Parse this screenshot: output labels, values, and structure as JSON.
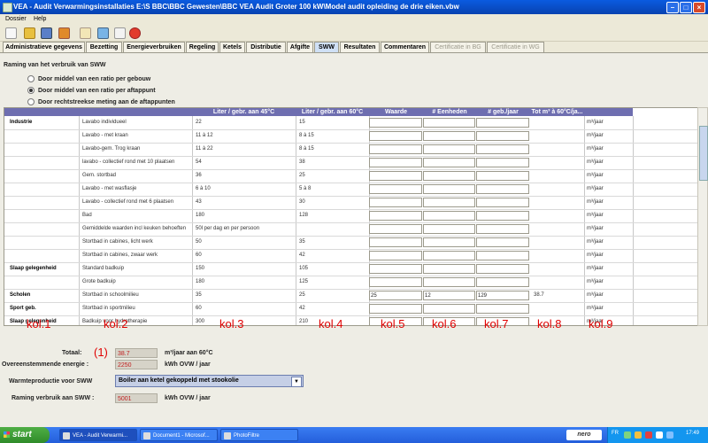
{
  "window": {
    "title": "VEA - Audit Verwarmingsinstallaties E:\\S BBC\\BBC Gewesten\\BBC VEA Audit Groter 100 kW\\Model audit opleiding de drie eiken.vbw"
  },
  "menu": [
    "Dossier",
    "Help"
  ],
  "tabs": [
    {
      "label": "Administratieve gegevens",
      "state": "normal"
    },
    {
      "label": "Bezetting",
      "state": "normal"
    },
    {
      "label": "Energieverbruiken",
      "state": "normal"
    },
    {
      "label": "Regeling",
      "state": "normal"
    },
    {
      "label": "Ketels",
      "state": "normal"
    },
    {
      "label": "Distributie",
      "state": "normal"
    },
    {
      "label": "Afgifte",
      "state": "normal"
    },
    {
      "label": "SWW",
      "state": "active"
    },
    {
      "label": "Resultaten",
      "state": "normal"
    },
    {
      "label": "Commentaren",
      "state": "normal"
    },
    {
      "label": "Certificatie in BG",
      "state": "disabled"
    },
    {
      "label": "Certificatie in WG",
      "state": "disabled"
    }
  ],
  "section": {
    "title": "Raming van het verbruik van SWW",
    "options": [
      {
        "label": "Door middel van een ratio per gebouw",
        "selected": false
      },
      {
        "label": "Door middel van een ratio per aftappunt",
        "selected": true
      },
      {
        "label": "Door rechtstreekse meting aan de aftappunten",
        "selected": false
      }
    ]
  },
  "table": {
    "headers": [
      "",
      "",
      "Liter / gebr. aan 45°C",
      "Liter / gebr. aan 60°C",
      "Waarde",
      "# Eenheden",
      "# geb./jaar",
      "Tot m³ à 60°C/ja...",
      ""
    ],
    "rows": [
      {
        "cat": "Industrie",
        "item": "Lavabo individueel",
        "l45": "22",
        "l60": "15",
        "waarde": "",
        "eenheden": "",
        "geb": "",
        "tot": "",
        "unit": "m³/jaar"
      },
      {
        "cat": "",
        "item": "Lavabo - met kraan",
        "l45": "11 à 12",
        "l60": "8 à 15",
        "waarde": "",
        "eenheden": "",
        "geb": "",
        "tot": "",
        "unit": "m³/jaar"
      },
      {
        "cat": "",
        "item": "Lavabo-gem. Trog kraan",
        "l45": "11 à 22",
        "l60": "8 à 15",
        "waarde": "",
        "eenheden": "",
        "geb": "",
        "tot": "",
        "unit": "m³/jaar"
      },
      {
        "cat": "",
        "item": "lavabo - collectief rond met 10 plaatsen",
        "l45": "54",
        "l60": "38",
        "waarde": "",
        "eenheden": "",
        "geb": "",
        "tot": "",
        "unit": "m³/jaar"
      },
      {
        "cat": "",
        "item": "Gem. stortbad",
        "l45": "36",
        "l60": "25",
        "waarde": "",
        "eenheden": "",
        "geb": "",
        "tot": "",
        "unit": "m³/jaar"
      },
      {
        "cat": "",
        "item": "Lavabo - met wasflasje",
        "l45": "6 à 10",
        "l60": "5 à 8",
        "waarde": "",
        "eenheden": "",
        "geb": "",
        "tot": "",
        "unit": "m³/jaar"
      },
      {
        "cat": "",
        "item": "Lavabo - collectief rond met 6 plaatsen",
        "l45": "43",
        "l60": "30",
        "waarde": "",
        "eenheden": "",
        "geb": "",
        "tot": "",
        "unit": "m³/jaar"
      },
      {
        "cat": "",
        "item": "Bad",
        "l45": "180",
        "l60": "128",
        "waarde": "",
        "eenheden": "",
        "geb": "",
        "tot": "",
        "unit": "m³/jaar"
      },
      {
        "cat": "",
        "item": "Gemiddelde waarden incl keuken behoeften",
        "l45": "50l per dag en per persoon",
        "l60": "",
        "waarde": "",
        "eenheden": "",
        "geb": "",
        "tot": "",
        "unit": "m³/jaar"
      },
      {
        "cat": "",
        "item": "Stortbad in cabines, licht werk",
        "l45": "50",
        "l60": "35",
        "waarde": "",
        "eenheden": "",
        "geb": "",
        "tot": "",
        "unit": "m³/jaar"
      },
      {
        "cat": "",
        "item": "Stortbad in cabines, zwaar werk",
        "l45": "60",
        "l60": "42",
        "waarde": "",
        "eenheden": "",
        "geb": "",
        "tot": "",
        "unit": "m³/jaar"
      },
      {
        "cat": "Slaap gelegenheid",
        "item": "Standard badkuip",
        "l45": "150",
        "l60": "105",
        "waarde": "",
        "eenheden": "",
        "geb": "",
        "tot": "",
        "unit": "m³/jaar"
      },
      {
        "cat": "",
        "item": "Grote badkuip",
        "l45": "180",
        "l60": "125",
        "waarde": "",
        "eenheden": "",
        "geb": "",
        "tot": "",
        "unit": "m³/jaar"
      },
      {
        "cat": "Scholen",
        "item": "Stortbad in schoolmilieu",
        "l45": "35",
        "l60": "25",
        "waarde": "25",
        "eenheden": "12",
        "geb": "129",
        "tot": "38.7",
        "unit": "m³/jaar"
      },
      {
        "cat": "Sport geb.",
        "item": "Stortbad in sportmilieu",
        "l45": "60",
        "l60": "42",
        "waarde": "",
        "eenheden": "",
        "geb": "",
        "tot": "",
        "unit": "m³/jaar"
      },
      {
        "cat": "Slaap gelegenheid",
        "item": "Badkuip voor hydrotherapie",
        "l45": "300",
        "l60": "210",
        "waarde": "",
        "eenheden": "",
        "geb": "",
        "tot": "",
        "unit": "m³/jaar"
      }
    ]
  },
  "annotations": {
    "columns": [
      "kol.1",
      "kol.2",
      "kol.3",
      "kol.4",
      "kol.5",
      "kol.6",
      "kol.7",
      "kol.8",
      "kol.9"
    ],
    "marker": "(1)"
  },
  "summary": {
    "totaal_label": "Totaal:",
    "totaal_value": "38.7",
    "totaal_unit": "m³/jaar aan 60°C",
    "energie_label": "Overeenstemmende energie :",
    "energie_value": "2250",
    "energie_unit": "kWh OVW / jaar",
    "warmte_label": "Warmteproductie voor SWW",
    "warmte_value": "Boiler aan ketel gekoppeld met stookolie",
    "raming_label": "Raming verbruik aan SWW :",
    "raming_value": "5001",
    "raming_unit": "kWh OVW / jaar"
  },
  "taskbar": {
    "start": "start",
    "tasks": [
      "VEA - Audit Verwarmi...",
      "Document1 - Microsof...",
      "PhotoFiltre"
    ],
    "brand": "nero",
    "lang": "FR",
    "clock": "17:49"
  },
  "colors": {
    "accent": "#6e6eb0",
    "annotation": "#e00000",
    "titlebar": "#0a5be0"
  }
}
